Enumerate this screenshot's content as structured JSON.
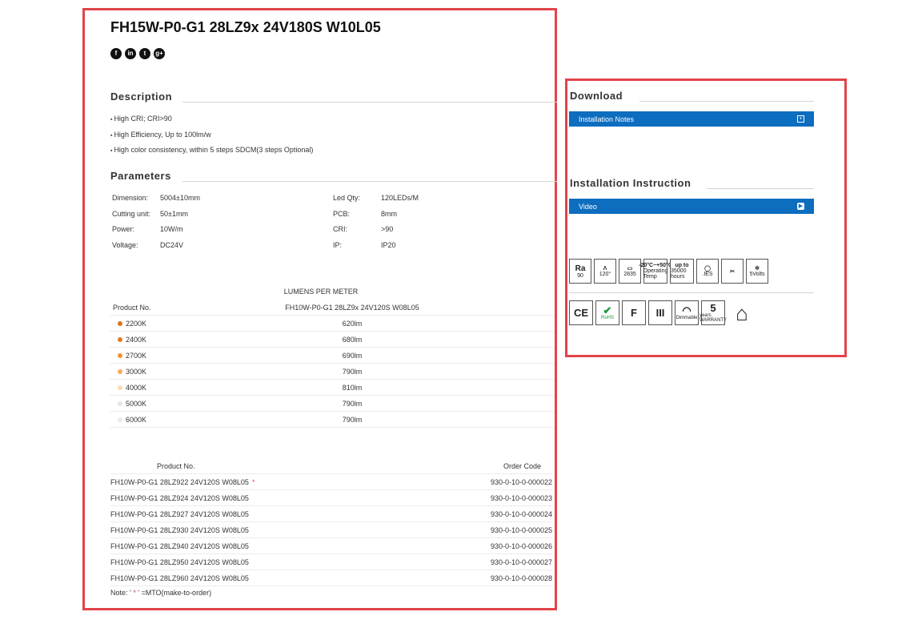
{
  "product": {
    "title": "FH15W-P0-G1 28LZ9x 24V180S W10L05",
    "social": [
      "f",
      "in",
      "t",
      "g+"
    ]
  },
  "description": {
    "heading": "Description",
    "items": [
      "High CRI; CRI>90",
      "High Efficiency, Up to 100lm/w",
      "High color consistency, within 5 steps SDCM(3 steps Optional)"
    ]
  },
  "parameters": {
    "heading": "Parameters",
    "left": [
      {
        "k": "Dimension:",
        "v": "5004±10mm"
      },
      {
        "k": "Cutting unit:",
        "v": "50±1mm"
      },
      {
        "k": "Power:",
        "v": "10W/m"
      },
      {
        "k": "Voltage:",
        "v": "DC24V"
      }
    ],
    "right": [
      {
        "k": "Led Qty:",
        "v": "120LEDs/M"
      },
      {
        "k": "PCB:",
        "v": "8mm"
      },
      {
        "k": "CRI:",
        "v": ">90"
      },
      {
        "k": "IP:",
        "v": "IP20"
      }
    ]
  },
  "lumens": {
    "heading": "LUMENS PER METER",
    "col1": "Product No.",
    "col2": "FH10W-P0-G1 28LZ9x 24V120S W08L05",
    "rows": [
      {
        "cct": "2200K",
        "lm": "620lm",
        "color": "#d9731c"
      },
      {
        "cct": "2400K",
        "lm": "680lm",
        "color": "#e07b22"
      },
      {
        "cct": "2700K",
        "lm": "690lm",
        "color": "#f0922c"
      },
      {
        "cct": "3000K",
        "lm": "790lm",
        "color": "#f5ab5c"
      },
      {
        "cct": "4000K",
        "lm": "810lm",
        "color": "#f8dcb4"
      },
      {
        "cct": "5000K",
        "lm": "790lm",
        "color": "#e4e6ea"
      },
      {
        "cct": "6000K",
        "lm": "790lm",
        "color": "#e8eaef"
      }
    ]
  },
  "orders": {
    "col1": "Product No.",
    "col2": "Order Code",
    "mto_mark": "*",
    "rows": [
      {
        "pn": "FH10W-P0-G1 28LZ922 24V120S W08L05",
        "code": "930-0-10-0-000022"
      },
      {
        "pn": "FH10W-P0-G1 28LZ924 24V120S W08L05",
        "code": "930-0-10-0-000023"
      },
      {
        "pn": "FH10W-P0-G1 28LZ927 24V120S W08L05",
        "code": "930-0-10-0-000024"
      },
      {
        "pn": "FH10W-P0-G1 28LZ930 24V120S W08L05",
        "code": "930-0-10-0-000025"
      },
      {
        "pn": "FH10W-P0-G1 28LZ940 24V120S W08L05",
        "code": "930-0-10-0-000026"
      },
      {
        "pn": "FH10W-P0-G1 28LZ950 24V120S W08L05",
        "code": "930-0-10-0-000027"
      },
      {
        "pn": "FH10W-P0-G1 28LZ960 24V120S W08L05",
        "code": "930-0-10-0-000028"
      }
    ],
    "note_prefix": "Note: '",
    "note_mark": " * ",
    "note_suffix": "' =MTO(make-to-order)"
  },
  "download": {
    "heading": "Download",
    "item": "Installation Notes",
    "item_icon": "+"
  },
  "install": {
    "heading": "Installation Instruction",
    "item": "Video",
    "item_icon": "▶"
  },
  "icons1": [
    {
      "top": "Ra",
      "bottom": "90",
      "name": "ra90-icon"
    },
    {
      "top": "Λ",
      "bottom": "120°",
      "name": "beam-angle-icon"
    },
    {
      "top": "▭",
      "bottom": "2835",
      "name": "led-chip-icon"
    },
    {
      "top": "-20°C~+50°C",
      "bottom": "Operating Temp",
      "name": "operating-temp-icon"
    },
    {
      "top": "up to",
      "bottom": "35000 hours",
      "name": "lifetime-icon"
    },
    {
      "top": "◯",
      "bottom": ".IES",
      "name": "ies-icon"
    },
    {
      "top": "✂",
      "bottom": "",
      "name": "cuttable-icon"
    },
    {
      "top": "✲",
      "bottom": "5Volts",
      "name": "dimmable-5v-icon"
    }
  ],
  "icons2": [
    {
      "top": "CE",
      "bottom": "",
      "name": "ce-icon"
    },
    {
      "top": "✔",
      "bottom": "RoHS",
      "name": "rohs-icon"
    },
    {
      "top": "F",
      "bottom": "",
      "name": "f-mark-icon"
    },
    {
      "top": "III",
      "bottom": "",
      "name": "class-iii-icon"
    },
    {
      "top": "◠",
      "bottom": "Dimmable",
      "name": "dimmable-icon"
    },
    {
      "top": "5",
      "bottom": "years WARRANTY",
      "name": "warranty-icon"
    },
    {
      "top": "⌂",
      "bottom": "",
      "name": "indoor-icon"
    }
  ]
}
